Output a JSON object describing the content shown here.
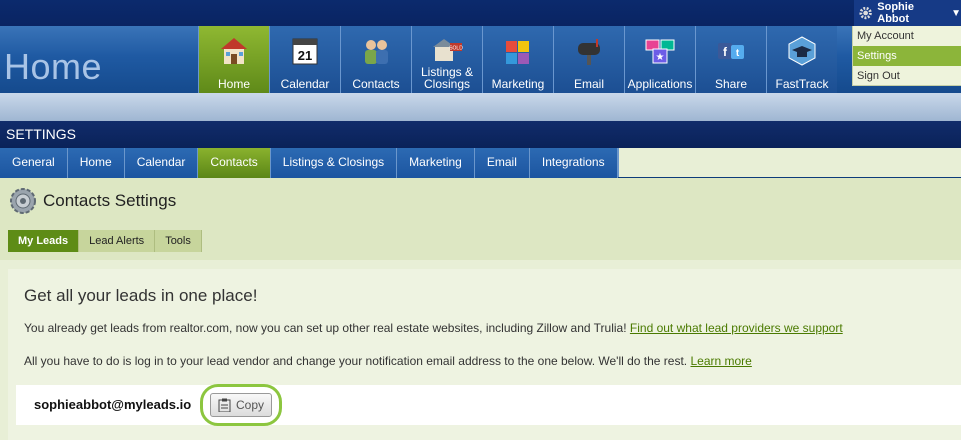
{
  "header": {
    "title": "Home"
  },
  "user": {
    "name": "Sophie Abbot"
  },
  "dropdown": {
    "items": [
      "My Account",
      "Settings",
      "Sign Out"
    ],
    "selected": "Settings"
  },
  "nav": {
    "items": [
      {
        "label": "Home",
        "icon": "house-icon"
      },
      {
        "label": "Calendar",
        "icon": "calendar-icon"
      },
      {
        "label": "Contacts",
        "icon": "people-icon"
      },
      {
        "label": "Listings & Closings",
        "icon": "sold-house-icon"
      },
      {
        "label": "Marketing",
        "icon": "puzzle-icon"
      },
      {
        "label": "Email",
        "icon": "mailbox-icon"
      },
      {
        "label": "Applications",
        "icon": "apps-icon"
      },
      {
        "label": "Share",
        "icon": "social-icon"
      },
      {
        "label": "FastTrack",
        "icon": "graduation-cap-icon"
      }
    ],
    "active": "Home"
  },
  "settings_bar": {
    "label": "SETTINGS"
  },
  "subnav": {
    "tabs": [
      "General",
      "Home",
      "Calendar",
      "Contacts",
      "Listings & Closings",
      "Marketing",
      "Email",
      "Integrations"
    ],
    "active": "Contacts"
  },
  "page": {
    "title": "Contacts Settings",
    "tabs": [
      "My Leads",
      "Lead Alerts",
      "Tools"
    ],
    "active_tab": "My Leads"
  },
  "card": {
    "heading": "Get all your leads in one place!",
    "p1_text": "You already get leads from realtor.com, now you can set up other real estate websites, including Zillow and Trulia!",
    "p1_link": "Find out what lead providers we support",
    "p2_text": "All you have to do is log in to your lead vendor and change your notification email address to the one below. We'll do the rest.",
    "p2_link": "Learn more",
    "email": "sophieabbot@myleads.io",
    "copy_label": "Copy"
  },
  "colors": {
    "accent_green": "#8cb53a",
    "nav_blue": "#1e5aa3",
    "dark_blue": "#0a2462"
  }
}
